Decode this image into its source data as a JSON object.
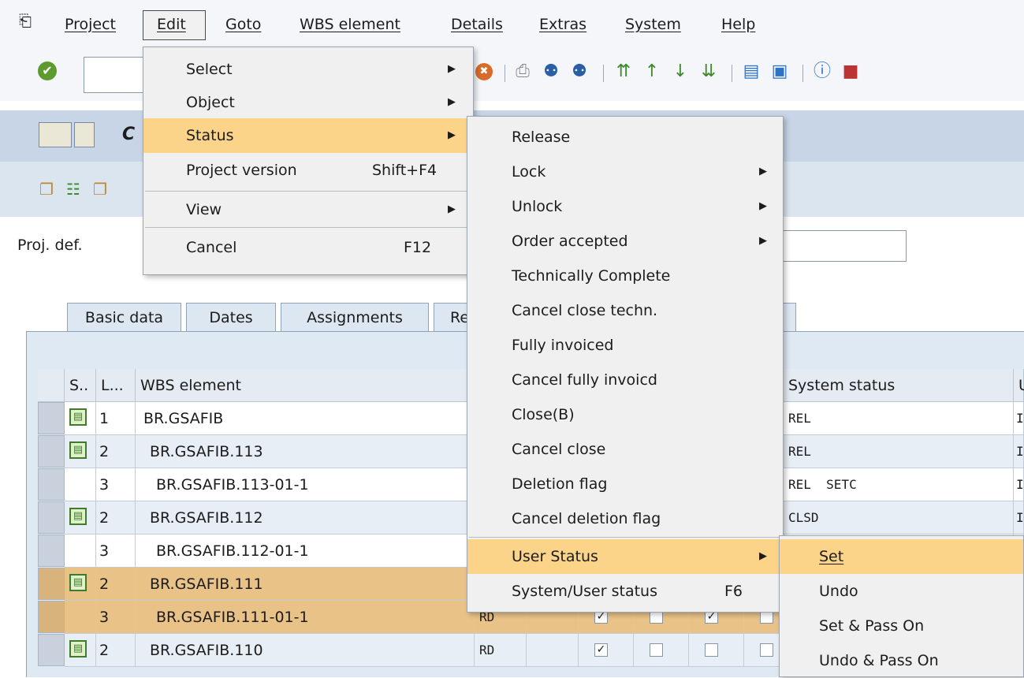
{
  "menubar": {
    "items": [
      "Project",
      "Edit",
      "Goto",
      "WBS element",
      "Details",
      "Extras",
      "System",
      "Help"
    ]
  },
  "title_partial": "C",
  "projdef_label": "Proj. def.",
  "tabs": [
    "Basic data",
    "Dates",
    "Assignments",
    "Re"
  ],
  "table": {
    "headers": [
      "S..",
      "L...",
      "WBS element",
      "System status",
      "U"
    ],
    "rows": [
      {
        "level": "1",
        "wbs": "BR.GSAFIB",
        "status": "REL",
        "extra": "I",
        "icon": true
      },
      {
        "level": "2",
        "wbs": "BR.GSAFIB.113",
        "status": "REL",
        "extra": "I",
        "icon": true
      },
      {
        "level": "3",
        "wbs": "BR.GSAFIB.113-01-1",
        "status": "REL  SETC",
        "extra": "I",
        "icon": false
      },
      {
        "level": "2",
        "wbs": "BR.GSAFIB.112",
        "status": "CLSD",
        "extra": "I",
        "icon": true
      },
      {
        "level": "3",
        "wbs": "BR.GSAFIB.112-01-1",
        "status": "",
        "extra": "",
        "icon": false
      },
      {
        "level": "2",
        "wbs": "BR.GSAFIB.111",
        "status": "",
        "extra": "",
        "icon": true
      },
      {
        "level": "3",
        "wbs": "BR.GSAFIB.111-01-1",
        "status": "",
        "extra": "",
        "icon": false,
        "code": "RD"
      },
      {
        "level": "2",
        "wbs": "BR.GSAFIB.110",
        "status": "",
        "extra": "",
        "icon": true,
        "code": "RD"
      }
    ]
  },
  "edit_menu": {
    "items": [
      {
        "label": "Select",
        "shortcut": "",
        "submenu": true
      },
      {
        "label": "Object",
        "shortcut": "",
        "submenu": true
      },
      {
        "label": "Status",
        "shortcut": "",
        "submenu": true
      },
      {
        "label": "Project version",
        "shortcut": "Shift+F4",
        "submenu": false
      },
      {
        "label": "View",
        "shortcut": "",
        "submenu": true
      },
      {
        "label": "Cancel",
        "shortcut": "F12",
        "submenu": false
      }
    ]
  },
  "status_menu": {
    "items": [
      {
        "label": "Release",
        "shortcut": "",
        "submenu": false
      },
      {
        "label": "Lock",
        "shortcut": "",
        "submenu": true
      },
      {
        "label": "Unlock",
        "shortcut": "",
        "submenu": true
      },
      {
        "label": "Order accepted",
        "shortcut": "",
        "submenu": true
      },
      {
        "label": "Technically Complete",
        "shortcut": "",
        "submenu": false
      },
      {
        "label": "Cancel close techn.",
        "shortcut": "",
        "submenu": false
      },
      {
        "label": "Fully invoiced",
        "shortcut": "",
        "submenu": false
      },
      {
        "label": "Cancel fully invoicd",
        "shortcut": "",
        "submenu": false
      },
      {
        "label": "Close(B)",
        "shortcut": "",
        "submenu": false
      },
      {
        "label": "Cancel close",
        "shortcut": "",
        "submenu": false
      },
      {
        "label": "Deletion flag",
        "shortcut": "",
        "submenu": false
      },
      {
        "label": "Cancel deletion flag",
        "shortcut": "",
        "submenu": false
      },
      {
        "label": "User Status",
        "shortcut": "",
        "submenu": true
      },
      {
        "label": "System/User status",
        "shortcut": "F6",
        "submenu": false
      }
    ]
  },
  "user_status_menu": {
    "items": [
      "Set",
      "Undo",
      "Set & Pass On",
      "Undo & Pass On"
    ]
  },
  "colors": {
    "highlight": "#fbd489",
    "row_highlight": "#e9c288",
    "title_bar": "#c7d5e7"
  }
}
